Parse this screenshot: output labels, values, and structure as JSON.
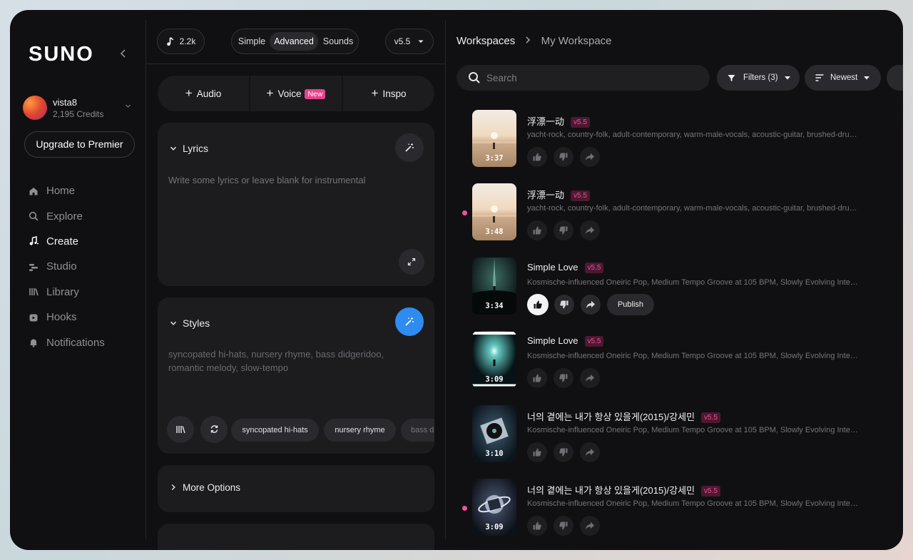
{
  "sidebar": {
    "logo": "SUNO",
    "user": {
      "name": "vista8",
      "credits": "2,195 Credits"
    },
    "upgrade_label": "Upgrade to Premier",
    "nav": [
      {
        "label": "Home",
        "icon": "home-icon"
      },
      {
        "label": "Explore",
        "icon": "explore-icon"
      },
      {
        "label": "Create",
        "icon": "create-icon",
        "active": true
      },
      {
        "label": "Studio",
        "icon": "studio-icon"
      },
      {
        "label": "Library",
        "icon": "library-icon"
      },
      {
        "label": "Hooks",
        "icon": "hooks-icon"
      },
      {
        "label": "Notifications",
        "icon": "bell-icon"
      }
    ]
  },
  "create": {
    "count": "2.2k",
    "modes": [
      "Simple",
      "Advanced",
      "Sounds"
    ],
    "active_mode": "Advanced",
    "version": "v5.5",
    "add": {
      "audio": "Audio",
      "voice": "Voice",
      "voice_badge": "New",
      "inspo": "Inspo"
    },
    "lyrics": {
      "title": "Lyrics",
      "placeholder": "Write some lyrics or leave blank for instrumental"
    },
    "styles": {
      "title": "Styles",
      "placeholder": "syncopated hi-hats, nursery rhyme, bass didgeridoo, romantic melody, slow-tempo",
      "tags": [
        "syncopated hi-hats",
        "nursery rhyme",
        "bass didgeridoo"
      ]
    },
    "more_options": "More Options"
  },
  "workspace": {
    "breadcrumb": [
      "Workspaces",
      "My Workspace"
    ],
    "search_placeholder": "Search",
    "filters_label": "Filters (3)",
    "sort_label": "Newest",
    "publish_label": "Publish",
    "songs": [
      {
        "title": "浮漂一动",
        "version": "v5.5",
        "duration": "3:37",
        "description": "yacht-rock, country-folk, adult-contemporary, warm-male-vocals, acoustic-guitar, brushed-drums, smooth-bass, layered-harmonies, relaxed-groove, gentle-tempo",
        "new": false,
        "art": "beach"
      },
      {
        "title": "浮漂一动",
        "version": "v5.5",
        "duration": "3:48",
        "description": "yacht-rock, country-folk, adult-contemporary, warm-male-vocals, acoustic-guitar, brushed-drums, smooth-bass, layered-harmonies, relaxed-groove, gentle-tempo",
        "new": true,
        "art": "beach"
      },
      {
        "title": "Simple Love",
        "version": "v5.5",
        "duration": "3:34",
        "description": "Kosmische-influenced Oneiric Pop, Medium Tempo Groove at 105 BPM, Slowly Evolving Interstellar Pads",
        "new": false,
        "art": "space",
        "liked": true
      },
      {
        "title": "Simple Love",
        "version": "v5.5",
        "duration": "3:09",
        "description": "Kosmische-influenced Oneiric Pop, Medium Tempo Groove at 105 BPM, Slowly Evolving Interstellar Pads",
        "new": false,
        "art": "burst"
      },
      {
        "title": "너의 곁에는 내가 항상 있을게(2015)/강세민",
        "version": "v5.5",
        "duration": "3:10",
        "description": "Kosmische-influenced Oneiric Pop, Medium Tempo Groove at 105 BPM, Slowly Evolving Interstellar Pads",
        "new": false,
        "art": "vinyl"
      },
      {
        "title": "너의 곁에는 내가 항상 있을게(2015)/강세민",
        "version": "v5.5",
        "duration": "3:09",
        "description": "Kosmische-influenced Oneiric Pop, Medium Tempo Groove at 105 BPM, Slowly Evolving Interstellar Pads",
        "new": true,
        "art": "planet"
      }
    ]
  },
  "colors": {
    "accent_blue": "#2e8cf0",
    "accent_pink": "#e9428d",
    "background": "#101012"
  }
}
